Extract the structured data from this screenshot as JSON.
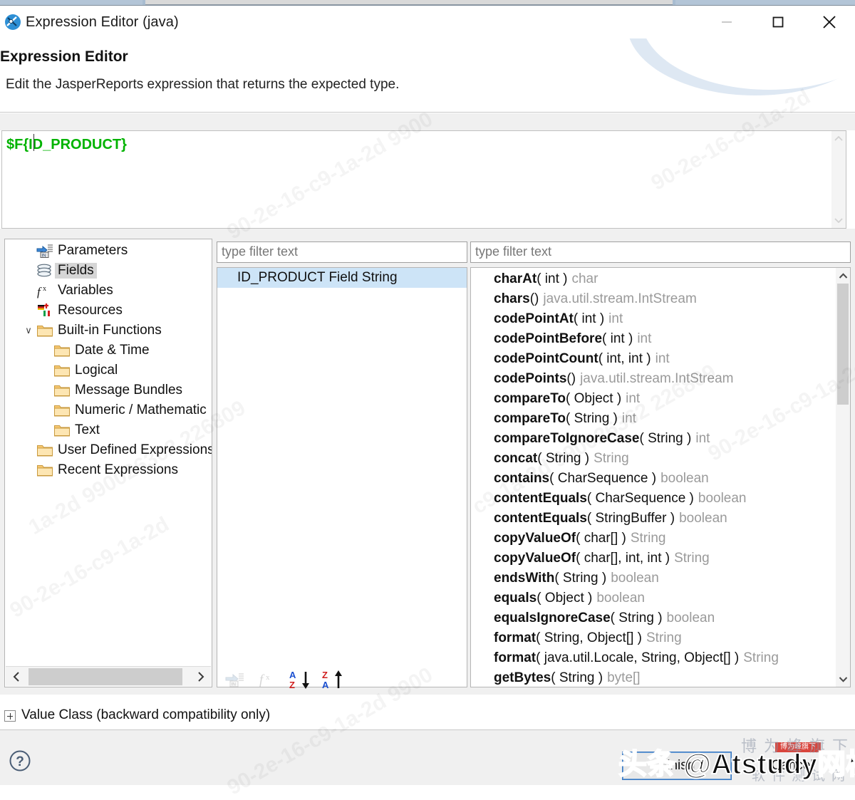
{
  "window": {
    "title": "Expression Editor (java)",
    "app_icon": "jaspersoft-icon",
    "minimize_label": "–",
    "maximize_label": "□",
    "close_label": "✕"
  },
  "header": {
    "title": "Expression Editor",
    "subtitle": "Edit the JasperReports expression that returns the expected type."
  },
  "expression": {
    "value": "$F{ID_PRODUCT}",
    "color": "#00b300"
  },
  "tree": {
    "items": [
      {
        "label": "Parameters",
        "icon": "parameters-icon",
        "indent": 1,
        "selected": false,
        "twisty": ""
      },
      {
        "label": "Fields",
        "icon": "fields-icon",
        "indent": 1,
        "selected": true,
        "twisty": ""
      },
      {
        "label": "Variables",
        "icon": "variables-fx-icon",
        "indent": 1,
        "selected": false,
        "twisty": ""
      },
      {
        "label": "Resources",
        "icon": "resources-flags-icon",
        "indent": 1,
        "selected": false,
        "twisty": ""
      },
      {
        "label": "Built-in Functions",
        "icon": "folder-icon",
        "indent": 1,
        "selected": false,
        "twisty": "∨"
      },
      {
        "label": "Date & Time",
        "icon": "folder-icon",
        "indent": 2,
        "selected": false,
        "twisty": ""
      },
      {
        "label": "Logical",
        "icon": "folder-icon",
        "indent": 2,
        "selected": false,
        "twisty": ""
      },
      {
        "label": "Message Bundles",
        "icon": "folder-icon",
        "indent": 2,
        "selected": false,
        "twisty": ""
      },
      {
        "label": "Numeric / Mathematic",
        "icon": "folder-icon",
        "indent": 2,
        "selected": false,
        "twisty": ""
      },
      {
        "label": "Text",
        "icon": "folder-icon",
        "indent": 2,
        "selected": false,
        "twisty": ""
      },
      {
        "label": "User Defined Expressions",
        "icon": "folder-icon",
        "indent": 1,
        "selected": false,
        "twisty": ""
      },
      {
        "label": "Recent Expressions",
        "icon": "folder-icon",
        "indent": 1,
        "selected": false,
        "twisty": ""
      }
    ],
    "hscroll": {
      "left_arrow": "‹",
      "right_arrow": "›"
    }
  },
  "middle": {
    "filter_placeholder": "type filter text",
    "filter_value": "",
    "items": [
      {
        "label": "ID_PRODUCT Field String",
        "selected": true
      }
    ],
    "toolbar": [
      {
        "name": "insert-parameter-icon",
        "enabled": false
      },
      {
        "name": "insert-function-icon",
        "enabled": false
      },
      {
        "name": "sort-az-down-icon",
        "enabled": true
      },
      {
        "name": "sort-za-up-icon",
        "enabled": true
      }
    ]
  },
  "right": {
    "filter_placeholder": "type filter text",
    "filter_value": "",
    "methods": [
      {
        "name": "charAt",
        "params": "( int )",
        "ret": "char"
      },
      {
        "name": "chars",
        "params": "()",
        "ret": "java.util.stream.IntStream"
      },
      {
        "name": "codePointAt",
        "params": "( int )",
        "ret": "int"
      },
      {
        "name": "codePointBefore",
        "params": "( int )",
        "ret": "int"
      },
      {
        "name": "codePointCount",
        "params": "( int, int )",
        "ret": "int"
      },
      {
        "name": "codePoints",
        "params": "()",
        "ret": "java.util.stream.IntStream"
      },
      {
        "name": "compareTo",
        "params": "( Object )",
        "ret": "int"
      },
      {
        "name": "compareTo",
        "params": "( String )",
        "ret": "int"
      },
      {
        "name": "compareToIgnoreCase",
        "params": "( String )",
        "ret": "int"
      },
      {
        "name": "concat",
        "params": "( String )",
        "ret": "String"
      },
      {
        "name": "contains",
        "params": "( CharSequence )",
        "ret": "boolean"
      },
      {
        "name": "contentEquals",
        "params": "( CharSequence )",
        "ret": "boolean"
      },
      {
        "name": "contentEquals",
        "params": "( StringBuffer )",
        "ret": "boolean"
      },
      {
        "name": "copyValueOf",
        "params": "( char[] )",
        "ret": "String"
      },
      {
        "name": "copyValueOf",
        "params": "( char[], int, int )",
        "ret": "String"
      },
      {
        "name": "endsWith",
        "params": "( String )",
        "ret": "boolean"
      },
      {
        "name": "equals",
        "params": "( Object )",
        "ret": "boolean"
      },
      {
        "name": "equalsIgnoreCase",
        "params": "( String )",
        "ret": "boolean"
      },
      {
        "name": "format",
        "params": "( String, Object[] )",
        "ret": "String"
      },
      {
        "name": "format",
        "params": "( java.util.Locale, String, Object[] )",
        "ret": "String"
      },
      {
        "name": "getBytes",
        "params": "( String )",
        "ret": "byte[]"
      }
    ],
    "scrollbar": {
      "up_arrow": "∧",
      "down_arrow": "∨"
    }
  },
  "value_class": {
    "label": "Value Class (backward compatibility only)",
    "expander": "+"
  },
  "footer": {
    "help_icon": "help-question-icon",
    "finish_label": "Finish",
    "cancel_label": "Cancel"
  },
  "watermark": {
    "brand": "头条 @Atstudy网校",
    "sub": "博为峰旗下",
    "sub2": "软件测试网",
    "tiles": [
      "90-2e-16-c9-1a-2d 9900",
      "1a-2d 990026362 226809",
      "90-2e-16-c9-1a-2d",
      "c9-1a-2d 990026362 226809",
      "90-2e-16-c9-1a-2d 9900"
    ]
  }
}
